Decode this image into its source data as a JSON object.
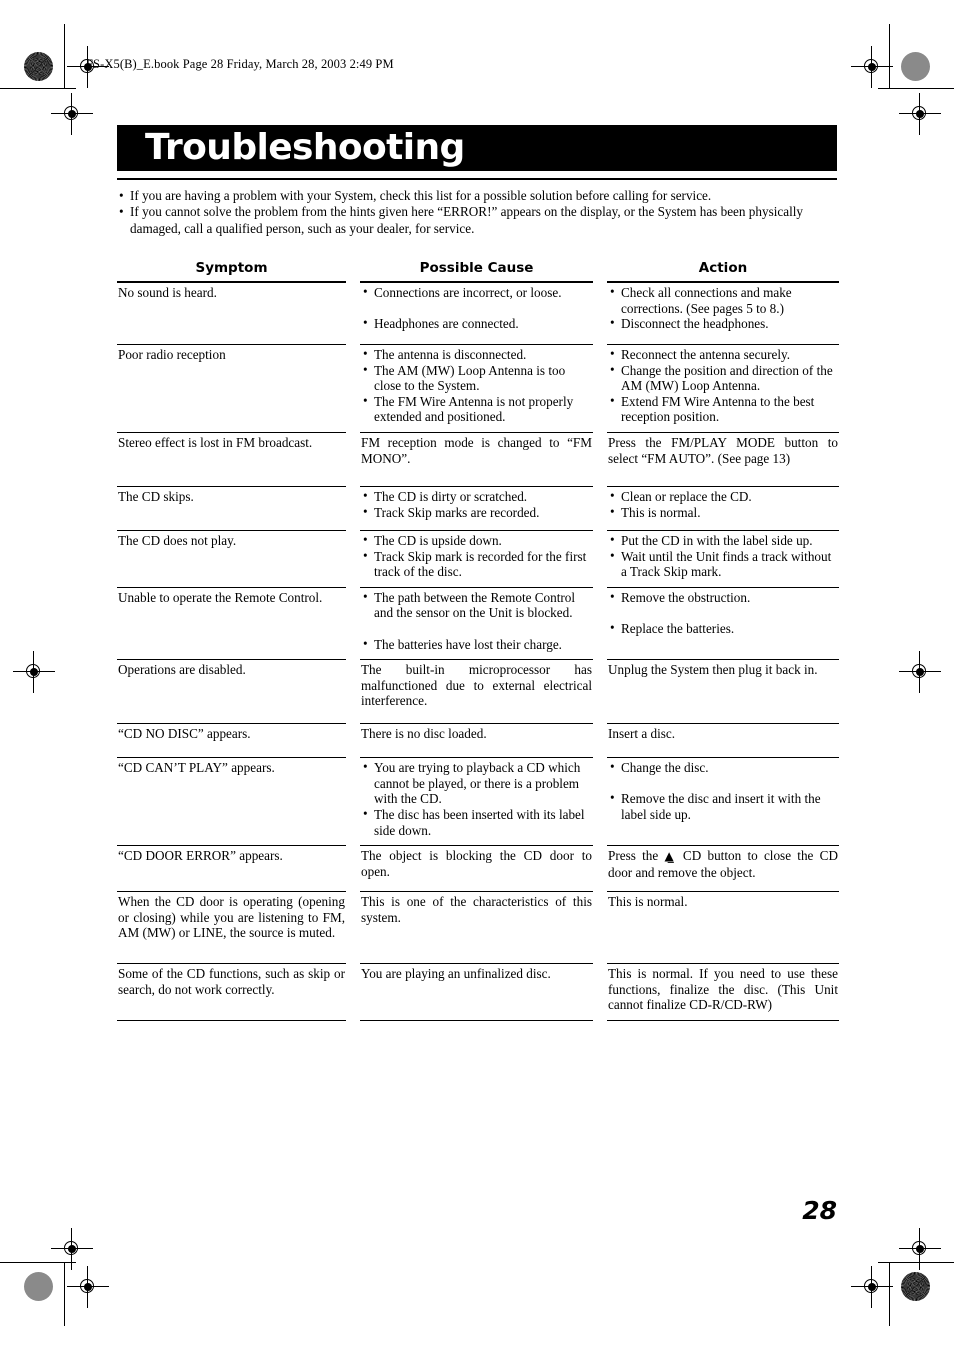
{
  "file_meta": "FS-X5(B)_E.book  Page 28  Friday, March 28, 2003  2:49 PM",
  "title": "Troubleshooting",
  "intro": [
    "If you are having a problem with your System, check this list for a possible solution before calling for service.",
    "If you cannot solve the problem from the hints given here “ERROR!” appears on the display, or the System has been physically damaged, call a qualified person, such as your dealer, for service."
  ],
  "bullet_glyph": "•",
  "eject_glyph": "⏏",
  "page_number": "28",
  "table": {
    "headers": [
      "Symptom",
      "Possible Cause",
      "Action"
    ],
    "rows": [
      {
        "symptom": [
          "No sound is heard."
        ],
        "cause": [
          "Connections are incorrect, or loose.",
          "Headphones are connected."
        ],
        "cause_bulleted": true,
        "cause_spaced": true,
        "action": [
          "Check all connections and make corrections. (See pages 5 to 8.)",
          "Disconnect the headphones."
        ],
        "action_bulleted": true
      },
      {
        "symptom": [
          "Poor radio reception"
        ],
        "cause": [
          "The antenna is disconnected.",
          "The AM (MW) Loop Antenna is too close to the System.",
          "The FM Wire Antenna is not properly extended and positioned."
        ],
        "cause_bulleted": true,
        "action": [
          "Reconnect the antenna securely.",
          "Change the position and direction of the AM (MW) Loop Antenna.",
          "Extend FM Wire Antenna to the best reception position."
        ],
        "action_bulleted": true
      },
      {
        "symptom": [
          "Stereo effect is lost in FM broadcast."
        ],
        "cause": [
          "FM reception mode is changed to “FM MONO”."
        ],
        "cause_bulleted": false,
        "cause_justify": true,
        "action": [
          "Press the FM/PLAY MODE button to select “FM AUTO”. (See page 13)"
        ],
        "action_bulleted": false,
        "action_justify": true
      },
      {
        "symptom": [
          "The CD skips."
        ],
        "cause": [
          "The CD is dirty or scratched.",
          "Track Skip marks are recorded."
        ],
        "cause_bulleted": true,
        "action": [
          "Clean or replace the CD.",
          "This is normal."
        ],
        "action_bulleted": true
      },
      {
        "symptom": [
          "The CD does not play."
        ],
        "cause": [
          "The CD is upside down.",
          "Track Skip mark is recorded for the first track of the disc."
        ],
        "cause_bulleted": true,
        "action": [
          "Put the CD in with the label side up.",
          "Wait until the Unit finds a track without a Track Skip mark."
        ],
        "action_bulleted": true
      },
      {
        "symptom": [
          "Unable to operate the Remote Control."
        ],
        "cause": [
          "The path between the Remote Control and the sensor on the Unit is blocked.",
          "The batteries have lost their charge."
        ],
        "cause_bulleted": true,
        "cause_spaced": true,
        "action": [
          "Remove the obstruction.",
          "Replace the batteries."
        ],
        "action_bulleted": true,
        "action_spaced_big": true
      },
      {
        "symptom": [
          "Operations are disabled."
        ],
        "cause": [
          "The built-in microprocessor has malfunctioned due to external electrical interference."
        ],
        "cause_bulleted": false,
        "cause_justify": true,
        "action": [
          "Unplug the System then plug it back in."
        ],
        "action_bulleted": false
      },
      {
        "symptom": [
          "“CD NO DISC” appears."
        ],
        "cause": [
          "There is no disc loaded."
        ],
        "cause_bulleted": false,
        "action": [
          "Insert a disc."
        ],
        "action_bulleted": false
      },
      {
        "symptom": [
          "“CD CAN’T PLAY” appears."
        ],
        "cause": [
          "You are trying to playback a CD which cannot be played, or there is a problem with the CD.",
          "The disc has been inserted with its label side down."
        ],
        "cause_bulleted": true,
        "action": [
          "Change the disc.",
          "Remove the disc and insert it with the label side up."
        ],
        "action_bulleted": true,
        "action_spaced_big2": true
      },
      {
        "symptom": [
          "“CD DOOR ERROR” appears."
        ],
        "cause": [
          "The object is blocking the CD door to open."
        ],
        "cause_bulleted": false,
        "cause_justify": true,
        "action_eject_prefix": "Press the ",
        "action_eject_suffix": " CD button to close the CD door and remove the object.",
        "action": [],
        "action_bulleted": false,
        "action_justify": true
      },
      {
        "symptom": [
          "When the CD door is operating (opening or closing) while you are listening to FM, AM (MW) or LINE, the source is muted."
        ],
        "symptom_justify": true,
        "cause": [
          "This is one of the characteristics of this system."
        ],
        "cause_bulleted": false,
        "cause_justify": true,
        "action": [
          "This is normal."
        ],
        "action_bulleted": false
      },
      {
        "symptom": [
          "Some of the CD functions, such as skip or search, do not work correctly."
        ],
        "symptom_justify": true,
        "cause": [
          "You are playing an unfinalized disc."
        ],
        "cause_bulleted": false,
        "action": [
          "This is normal. If you need to use these functions, finalize the disc. (This Unit cannot finalize CD-R/CD-RW)"
        ],
        "action_bulleted": false,
        "action_justify": true
      }
    ]
  }
}
